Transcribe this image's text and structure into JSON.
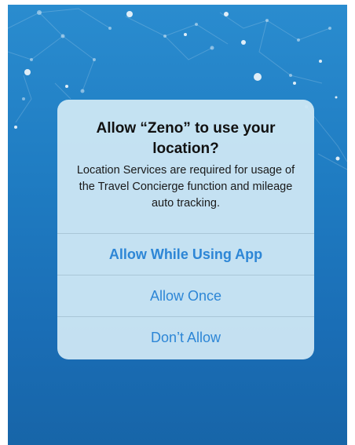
{
  "background": {
    "colors": [
      "#2a8ccf",
      "#1765a8"
    ],
    "decoration": "constellation-network"
  },
  "alert": {
    "title": "Allow “Zeno” to use your location?",
    "message": "Location Services are required for usage of the Travel Concierge function and mileage auto tracking.",
    "buttons": [
      {
        "label": "Allow While Using App",
        "color": "#2d86d6",
        "emphasis": true
      },
      {
        "label": "Allow Once",
        "color": "#2d86d6",
        "emphasis": false
      },
      {
        "label": "Don’t Allow",
        "color": "#2d86d6",
        "emphasis": false
      }
    ]
  }
}
